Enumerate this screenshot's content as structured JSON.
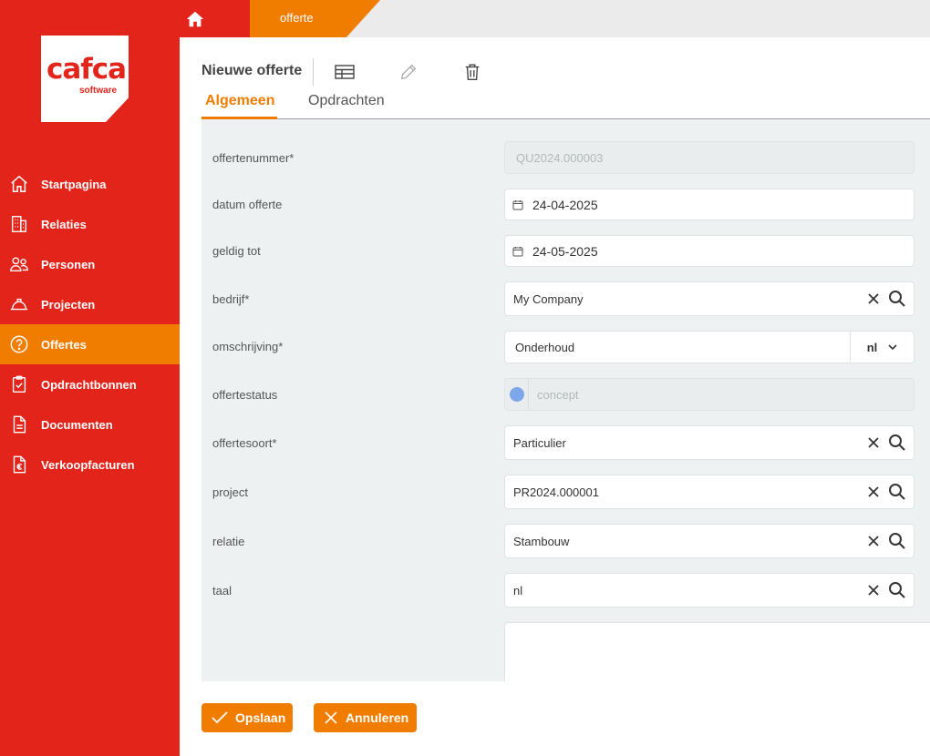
{
  "logo": {
    "word": "cafca",
    "sub": "software"
  },
  "breadcrumb": {
    "current": "offerte"
  },
  "sidebar": {
    "items": [
      {
        "label": "Startpagina",
        "icon": "home-icon"
      },
      {
        "label": "Relaties",
        "icon": "building-icon"
      },
      {
        "label": "Personen",
        "icon": "people-icon"
      },
      {
        "label": "Projecten",
        "icon": "hard-hat-icon"
      },
      {
        "label": "Offertes",
        "icon": "question-circle-icon",
        "active": true
      },
      {
        "label": "Opdrachtbonnen",
        "icon": "clipboard-check-icon"
      },
      {
        "label": "Documenten",
        "icon": "document-icon"
      },
      {
        "label": "Verkoopfacturen",
        "icon": "euro-document-icon"
      }
    ]
  },
  "header": {
    "title": "Nieuwe offerte"
  },
  "tabs": [
    {
      "label": "Algemeen",
      "active": true
    },
    {
      "label": "Opdrachten"
    }
  ],
  "form": {
    "offertenummer": {
      "label": "offertenummer*",
      "value": "QU2024.000003"
    },
    "datum_offerte": {
      "label": "datum offerte",
      "value": "24-04-2025"
    },
    "geldig_tot": {
      "label": "geldig tot",
      "value": "24-05-2025"
    },
    "bedrijf": {
      "label": "bedrijf*",
      "value": "My Company"
    },
    "omschrijving": {
      "label": "omschrijving*",
      "value": "Onderhoud",
      "lang": "nl"
    },
    "offertestatus": {
      "label": "offertestatus",
      "value": "concept"
    },
    "offertesoort": {
      "label": "offertesoort*",
      "value": "Particulier"
    },
    "project": {
      "label": "project",
      "value": "PR2024.000001"
    },
    "relatie": {
      "label": "relatie",
      "value": "Stambouw"
    },
    "taal": {
      "label": "taal",
      "value": "nl"
    }
  },
  "buttons": {
    "save": "Opslaan",
    "cancel": "Annuleren"
  },
  "colors": {
    "brand_red": "#e3241b",
    "brand_orange": "#f07d00",
    "status_dot": "#7ea7ea"
  }
}
